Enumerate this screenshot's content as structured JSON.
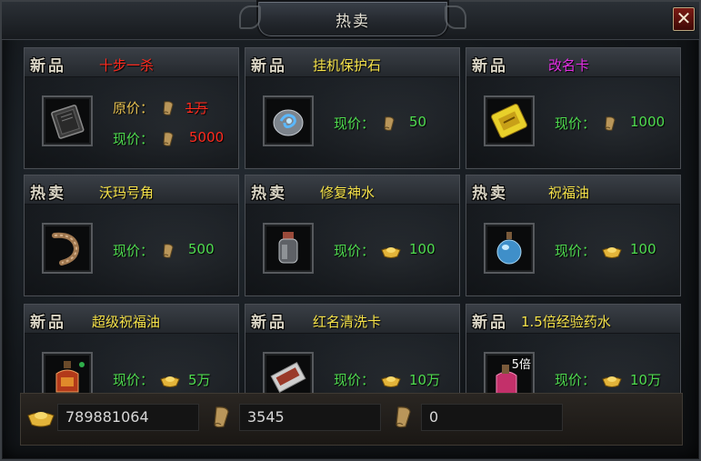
{
  "window": {
    "title": "热卖",
    "close_label": "✕"
  },
  "cards": [
    {
      "tag": "新品",
      "name": "十步一杀",
      "name_color": "#ff2a1e",
      "icon": "book-icon",
      "orig_label": "原价：",
      "orig_value": "1万",
      "orig_currency": "scroll-icon",
      "price_label": "现价：",
      "price_value": "5000",
      "price_currency": "scroll-icon",
      "value_color": "red"
    },
    {
      "tag": "新品",
      "name": "挂机保护石",
      "name_color": "#f5e24a",
      "icon": "blue-stone-icon",
      "price_label": "现价：",
      "price_value": "50",
      "price_currency": "scroll-icon"
    },
    {
      "tag": "新品",
      "name": "改名卡",
      "name_color": "#e42fe4",
      "icon": "rename-card-icon",
      "price_label": "现价：",
      "price_value": "1000",
      "price_currency": "scroll-icon"
    },
    {
      "tag": "热卖",
      "name": "沃玛号角",
      "name_color": "#f5e24a",
      "icon": "horn-icon",
      "price_label": "现价：",
      "price_value": "500",
      "price_currency": "scroll-icon"
    },
    {
      "tag": "热卖",
      "name": "修复神水",
      "name_color": "#f5e24a",
      "icon": "potion-jar-icon",
      "price_label": "现价：",
      "price_value": "100",
      "price_currency": "gold-ingot-icon"
    },
    {
      "tag": "热卖",
      "name": "祝福油",
      "name_color": "#f5e24a",
      "icon": "blessing-oil-icon",
      "price_label": "现价：",
      "price_value": "100",
      "price_currency": "gold-ingot-icon"
    },
    {
      "tag": "新品",
      "name": "超级祝福油",
      "name_color": "#f5e24a",
      "icon": "super-oil-icon",
      "price_label": "现价：",
      "price_value": "5万",
      "price_currency": "gold-ingot-icon"
    },
    {
      "tag": "新品",
      "name": "红名清洗卡",
      "name_color": "#f5e24a",
      "icon": "clean-card-icon",
      "price_label": "现价：",
      "price_value": "10万",
      "price_currency": "gold-ingot-icon"
    },
    {
      "tag": "新品",
      "name": "1.5倍经验药水",
      "name_color": "#f5e24a",
      "icon": "exp-potion-icon",
      "icon_badge": "5倍",
      "price_label": "现价：",
      "price_value": "10万",
      "price_currency": "gold-ingot-icon"
    }
  ],
  "balances": [
    {
      "currency": "gold-ingot-icon",
      "value": "789881064"
    },
    {
      "currency": "scroll-icon",
      "value": "3545"
    },
    {
      "currency": "scroll-icon",
      "value": "0"
    }
  ]
}
